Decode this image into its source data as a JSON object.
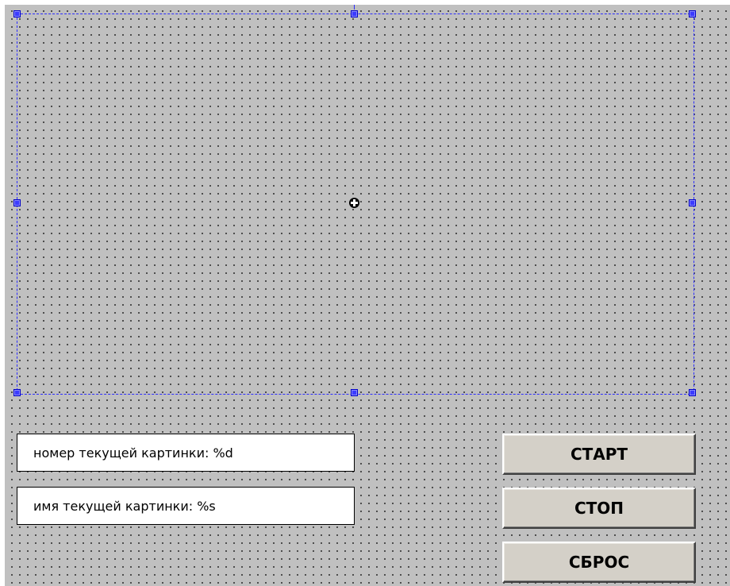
{
  "dialog": {
    "fields": {
      "current_number": "номер текущей картинки: %d",
      "current_name": "имя текущей картинки: %s"
    },
    "buttons": {
      "start": "СТАРТ",
      "stop": "СТОП",
      "reset": "СБРОС"
    }
  },
  "icons": {
    "center": "move-crosshair-icon",
    "handles": "resize-handle-icon"
  },
  "colors": {
    "canvas": "#c0c0c0",
    "selection": "#2d2dff",
    "button_face": "#d4d0c8"
  }
}
